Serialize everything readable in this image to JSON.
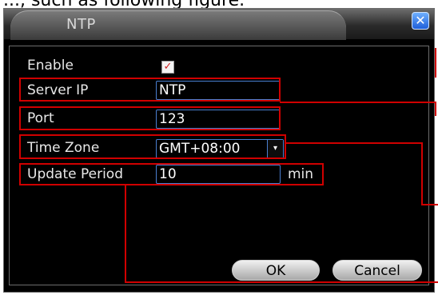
{
  "caption": "..., such as following figure.",
  "window": {
    "title": "NTP",
    "close_symbol": "✕"
  },
  "form": {
    "enable": {
      "label": "Enable",
      "checked": true,
      "mark": "✓"
    },
    "server_ip": {
      "label": "Server IP",
      "value": "NTP"
    },
    "port": {
      "label": "Port",
      "value": "123"
    },
    "time_zone": {
      "label": "Time Zone",
      "value": "GMT+08:00",
      "arrow": "▾"
    },
    "update_period": {
      "label": "Update Period",
      "value": "10",
      "unit": "min"
    }
  },
  "buttons": {
    "ok": "OK",
    "cancel": "Cancel"
  },
  "colors": {
    "annotation": "#d00000",
    "field_border": "#4a7fd0"
  }
}
